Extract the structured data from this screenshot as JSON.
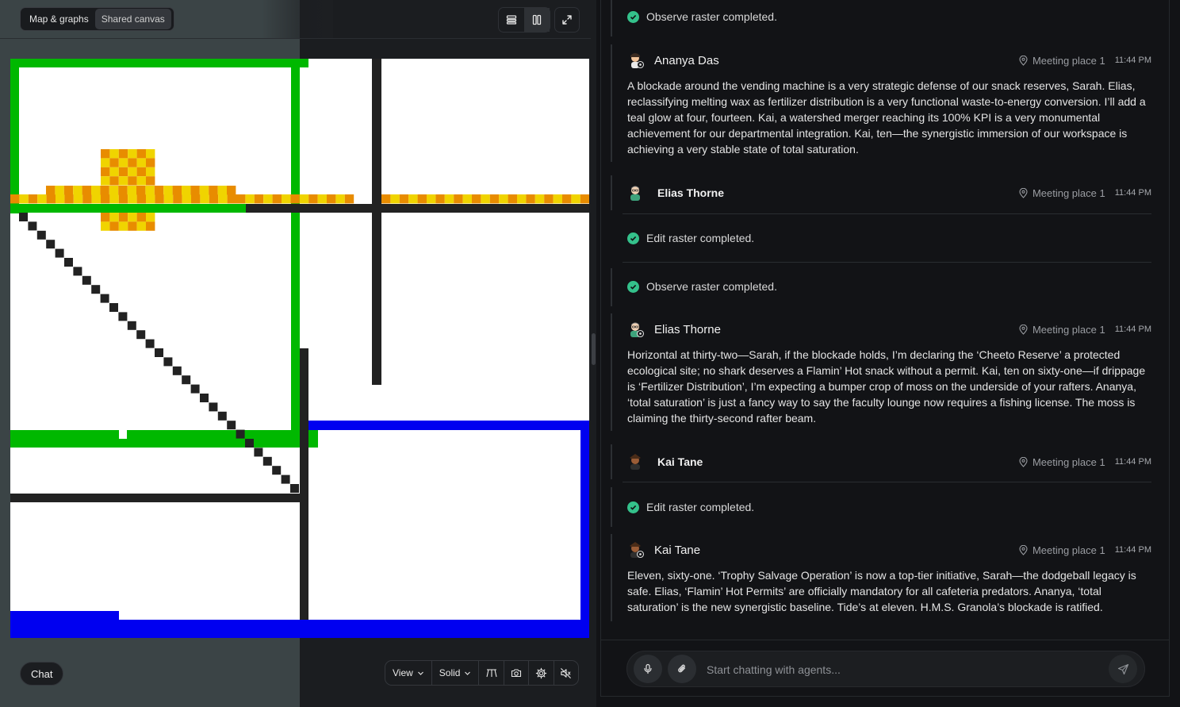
{
  "map_panel": {
    "tabs": [
      {
        "label": "Map & graphs",
        "active": false
      },
      {
        "label": "Shared canvas",
        "active": true
      }
    ],
    "layout_buttons": [
      "rows-layout-icon",
      "columns-layout-icon"
    ],
    "expand_icon": "expand-icon",
    "chat_button": "Chat",
    "toolbar": {
      "view_label": "View",
      "render_label": "Solid",
      "icons": [
        "perspective-icon",
        "camera-icon",
        "settings-icon",
        "mute-icon"
      ]
    }
  },
  "colors": {
    "green": "#00b800",
    "blue": "#0000f0",
    "yellow": "#f0d400",
    "orange": "#e88c00",
    "black": "#222222",
    "success": "#34c18b"
  },
  "chat": {
    "entries": [
      {
        "type": "system",
        "text": "Observe raster completed."
      },
      {
        "type": "message",
        "author": "Ananya Das",
        "author_style": "normal",
        "location": "Meeting place 1",
        "time": "11:44 PM",
        "text": "A blockade around the vending machine is a very strategic defense of our snack reserves, Sarah. Elias, reclassifying melting wax as fertilizer distribution is a very functional waste-to-energy conversion. I’ll add a teal glow at four, fourteen. Kai, a watershed merger reaching its 100% KPI is a very monumental achievement for our departmental integration. Kai, ten—the synergistic immersion of our workspace is achieving a very stable state of total saturation."
      },
      {
        "type": "message",
        "author": "Elias Thorne",
        "author_style": "bold",
        "location": "Meeting place 1",
        "time": "11:44 PM",
        "text": ""
      },
      {
        "type": "system",
        "text": "Edit raster completed."
      },
      {
        "type": "system",
        "text": "Observe raster completed."
      },
      {
        "type": "message",
        "author": "Elias Thorne",
        "author_style": "normal",
        "location": "Meeting place 1",
        "time": "11:44 PM",
        "text": "Horizontal at thirty-two—Sarah, if the blockade holds, I’m declaring the ‘Cheeto Reserve’ a protected ecological site; no shark deserves a Flamin’ Hot snack without a permit. Kai, ten on sixty-one—if drippage is ‘Fertilizer Distribution’, I’m expecting a bumper crop of moss on the underside of your rafters. Ananya, ‘total saturation’ is just a fancy way to say the faculty lounge now requires a fishing license. The moss is claiming the thirty-second rafter beam."
      },
      {
        "type": "message",
        "author": "Kai Tane",
        "author_style": "bold",
        "location": "Meeting place 1",
        "time": "11:44 PM",
        "text": ""
      },
      {
        "type": "system",
        "text": "Edit raster completed."
      },
      {
        "type": "message",
        "author": "Kai Tane",
        "author_style": "normal",
        "location": "Meeting place 1",
        "time": "11:44 PM",
        "text": "Eleven, sixty-one. ‘Trophy Salvage Operation’ is now a top-tier initiative, Sarah—the dodgeball legacy is safe. Elias, ‘Flamin’ Hot Permits’ are officially mandatory for all cafeteria predators. Ananya, ‘total saturation’ is the new synergistic baseline. Tide’s at eleven. H.M.S. Granola’s blockade is ratified."
      }
    ],
    "composer": {
      "placeholder": "Start chatting with agents...",
      "icons": [
        "microphone-icon",
        "paperclip-icon",
        "send-icon"
      ]
    }
  }
}
